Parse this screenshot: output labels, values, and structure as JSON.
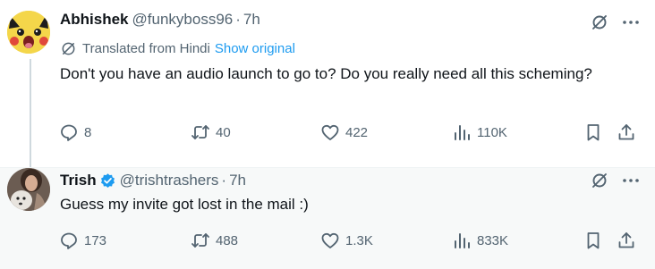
{
  "tweets": [
    {
      "name": "Abhishek",
      "handle": "@funkyboss96",
      "separator": "·",
      "time": "7h",
      "translated_label": "Translated from Hindi",
      "show_original": "Show original",
      "text": "Don't you have an audio launch to go to? Do you really need all this scheming?",
      "replies": "8",
      "retweets": "40",
      "likes": "422",
      "views": "110K",
      "avatar_icon": "pikachu-avatar-icon"
    },
    {
      "name": "Trish",
      "handle": "@trishtrashers",
      "separator": "·",
      "time": "7h",
      "text": "Guess my invite got lost in the mail :)",
      "replies": "173",
      "retweets": "488",
      "likes": "1.3K",
      "views": "833K",
      "verified": true,
      "avatar_icon": "photo-avatar-icon"
    }
  ],
  "colors": {
    "text": "#0f1419",
    "secondary": "#536471",
    "link": "#1d9bf0",
    "verified": "#1d9bf0",
    "thread_line": "#cfd9de",
    "highlight_bg": "#f7f9f9"
  },
  "icons": [
    "grok-icon",
    "more-icon",
    "translate-icon",
    "reply-icon",
    "retweet-icon",
    "like-icon",
    "views-icon",
    "bookmark-icon",
    "share-icon",
    "verified-badge-icon"
  ]
}
